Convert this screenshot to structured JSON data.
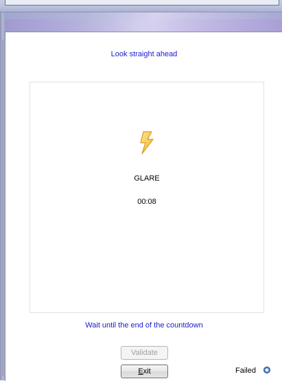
{
  "instructions": {
    "top": "Look straight ahead",
    "bottom": "Wait until the end of the countdown"
  },
  "test": {
    "mode": "GLARE",
    "icon": "lightning-bolt-icon",
    "countdown": "00:08"
  },
  "buttons": {
    "validate_label": "Validate",
    "exit_prefix": "E",
    "exit_rest": "xit"
  },
  "status": {
    "label": "Failed",
    "indicator_color": "#2f5fa8"
  },
  "colors": {
    "instruction_text": "#1a1ad0",
    "bolt_fill": "#f5c84a",
    "bolt_stroke": "#d89a1a"
  }
}
